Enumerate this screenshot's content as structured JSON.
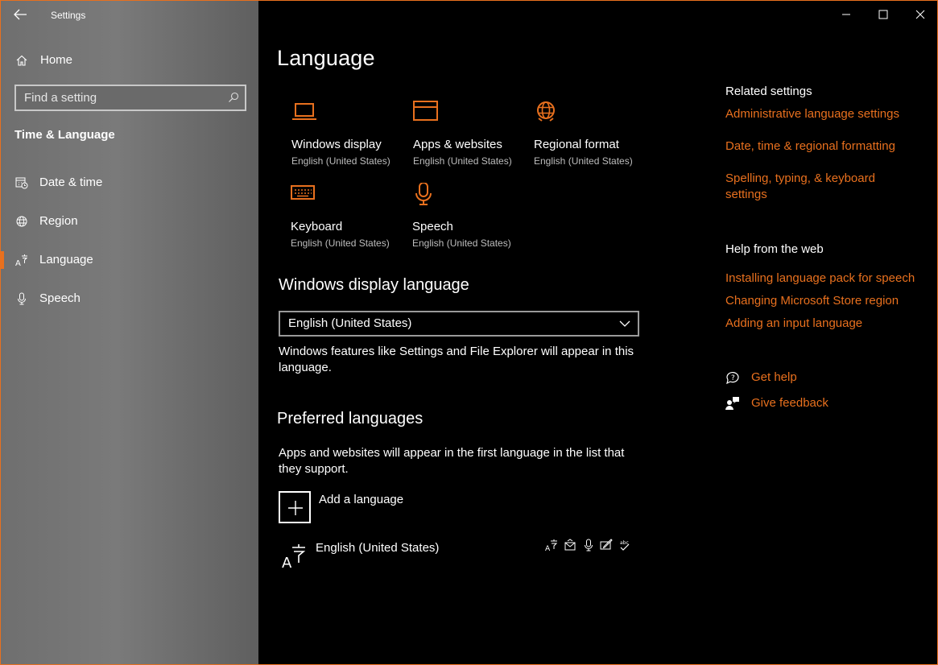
{
  "window": {
    "app_title": "Settings",
    "accent_color": "#e8701e"
  },
  "sidebar": {
    "home_label": "Home",
    "search_placeholder": "Find a setting",
    "section_title": "Time & Language",
    "items": [
      {
        "label": "Date & time",
        "icon": "calendar-clock-icon",
        "selected": false
      },
      {
        "label": "Region",
        "icon": "globe-icon",
        "selected": false
      },
      {
        "label": "Language",
        "icon": "language-icon",
        "selected": true
      },
      {
        "label": "Speech",
        "icon": "microphone-icon",
        "selected": false
      }
    ]
  },
  "main": {
    "title": "Language",
    "tiles": [
      {
        "label": "Windows display",
        "sub": "English (United States)",
        "icon": "laptop-icon"
      },
      {
        "label": "Apps & websites",
        "sub": "English (United States)",
        "icon": "browser-window-icon"
      },
      {
        "label": "Regional format",
        "sub": "English (United States)",
        "icon": "globe-icon"
      },
      {
        "label": "Keyboard",
        "sub": "English (United States)",
        "icon": "keyboard-icon"
      },
      {
        "label": "Speech",
        "sub": "English (United States)",
        "icon": "microphone-icon"
      }
    ],
    "display_language": {
      "heading": "Windows display language",
      "selected": "English (United States)",
      "description": "Windows features like Settings and File Explorer will appear in this language."
    },
    "preferred": {
      "heading": "Preferred languages",
      "description": "Apps and websites will appear in the first language in the list that they support.",
      "add_label": "Add a language",
      "languages": [
        {
          "name": "English (United States)",
          "features": [
            "display-language-icon",
            "text-to-speech-icon",
            "speech-recognition-icon",
            "handwriting-icon",
            "spell-check-icon"
          ]
        }
      ]
    }
  },
  "right": {
    "related_heading": "Related settings",
    "related_links": [
      "Administrative language settings",
      "Date, time & regional formatting",
      "Spelling, typing, & keyboard settings"
    ],
    "help_heading": "Help from the web",
    "help_links": [
      "Installing language pack for speech",
      "Changing Microsoft Store region",
      "Adding an input language"
    ],
    "get_help": "Get help",
    "give_feedback": "Give feedback"
  }
}
